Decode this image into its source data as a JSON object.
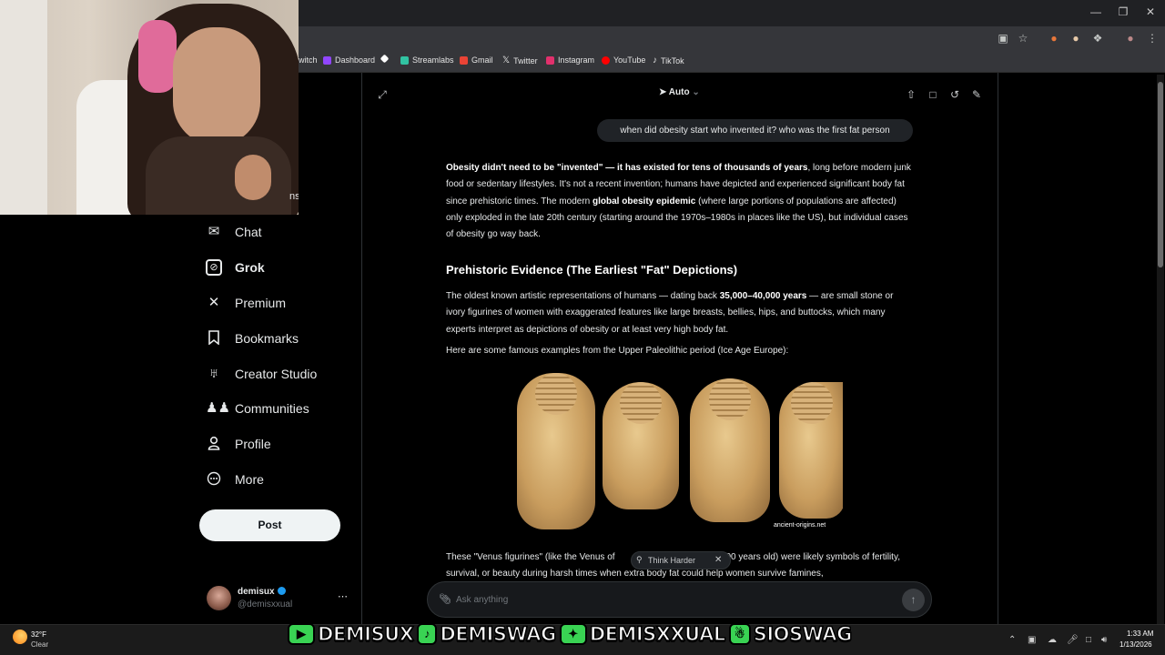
{
  "browser": {
    "bookmarks": [
      {
        "label": "witch",
        "color": "#9146ff"
      },
      {
        "label": "Dashboard",
        "color": "#9146ff"
      },
      {
        "label": "",
        "color": "#ffffff"
      },
      {
        "label": "Streamlabs",
        "color": "#31c3a2"
      },
      {
        "label": "Gmail",
        "color": "#ea4335"
      },
      {
        "label": "Twitter",
        "color": "#ffffff"
      },
      {
        "label": "Instagram",
        "color": "#e1306c"
      },
      {
        "label": "YouTube",
        "color": "#ff0000"
      },
      {
        "label": "TikTok",
        "color": "#ffffff"
      }
    ]
  },
  "webcam": {
    "partial_text": "ns"
  },
  "sidebar": {
    "items": [
      {
        "label": "Chat",
        "icon": "mail-icon"
      },
      {
        "label": "Grok",
        "icon": "grok-icon"
      },
      {
        "label": "Premium",
        "icon": "x-logo-icon"
      },
      {
        "label": "Bookmarks",
        "icon": "bookmark-icon"
      },
      {
        "label": "Creator Studio",
        "icon": "creator-studio-icon"
      },
      {
        "label": "Communities",
        "icon": "communities-icon"
      },
      {
        "label": "Profile",
        "icon": "profile-icon"
      },
      {
        "label": "More",
        "icon": "more-icon"
      }
    ],
    "post_label": "Post",
    "account": {
      "name": "demisux",
      "handle": "@demisxxual"
    }
  },
  "grok": {
    "mode": "Auto",
    "user_message": "when did obesity start who invented it? who was the first fat person",
    "intro_bold_1": "Obesity didn't need to be \"invented\" — it has existed for tens of thousands of years",
    "intro_1": ", long before modern junk food or sedentary lifestyles. It's not a recent invention; humans have depicted and experienced significant body fat since prehistoric times. The modern ",
    "intro_bold_2": "global obesity epidemic",
    "intro_2": " (where large portions of populations are affected) only exploded in the late 20th century (starting around the 1970s–1980s in places like the US), but individual cases of obesity go way back.",
    "heading": "Prehistoric Evidence (The Earliest \"Fat\" Depictions)",
    "para2_a": "The oldest known artistic representations of humans — dating back ",
    "para2_bold": "35,000–40,000 years",
    "para2_b": " — are small stone or ivory figurines of women with exaggerated features like large breasts, bellies, hips, and buttocks, which many experts interpret as depictions of obesity or at least very high body fat.",
    "para3": "Here are some famous examples from the Upper Paleolithic period (Ice Age Europe):",
    "image_caption": "ancient-origins.net",
    "para4_a": "These \"Venus figurines\" (like the Venus of",
    "para4_b": "0,000 years old) were likely symbols of fertility, survival, or beauty during harsh times when extra body fat could help women survive famines,",
    "para4_mid": "0",
    "think_harder_label": "Think Harder",
    "ask_placeholder": "Ask anything"
  },
  "taskbar": {
    "temperature": "32°F",
    "condition": "Clear",
    "time": "1:33 AM",
    "date": "1/13/2026"
  },
  "overlay": {
    "socials": [
      {
        "icon": "youtube-icon",
        "handle": "DEMISUX",
        "color": "#ff0000"
      },
      {
        "icon": "tiktok-icon",
        "handle": "DEMISWAG",
        "color": "#000000"
      },
      {
        "icon": "twitter-bird-icon",
        "handle": "DEMISXXUAL",
        "color": "#1da1f2"
      },
      {
        "icon": "snapchat-icon",
        "handle": "SIOSWAG",
        "color": "#fffc00"
      }
    ]
  },
  "colors": {
    "accent": "#1d9bf0",
    "background": "#000000",
    "overlay_green": "#39d353"
  }
}
